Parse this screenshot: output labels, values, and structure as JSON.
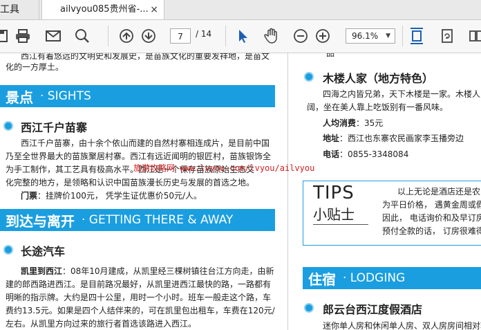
{
  "tabs": {
    "left_label": "工具",
    "doc_label": "ailvyou085贵州省-...",
    "close_glyph": "×"
  },
  "toolbar": {
    "page_current": "7",
    "page_total": "/ 14",
    "zoom": "96.1%"
  },
  "left": {
    "intro_tail_1": "西江有着悠远的文明史和发展史，是苗族文化的重要发祥地，是苗文",
    "intro_tail_2": "化的一方厚土。",
    "sights_banner_cn": "景点",
    "sights_banner_en": "· SIGHTS",
    "sight_title": "西江千户苗寨",
    "sight_body": [
      "西江千户苗寨，由十余个依山而建的自然村寨相连成片，是目前中国",
      "乃至全世界最大的苗族聚居村寨。西江有远近闻明的银匠村，苗族银饰全",
      "为手工制作，其工艺具有极高水平。西江是一个保存苗族原始生态文",
      "化完整的地方，是领略和认识中国苗族漫长历史与发展的首选之地。"
    ],
    "ticket_label": "门票",
    "ticket_value": "：挂牌价100元， 凭学生证优惠价50元/人。",
    "transport_banner_cn": "到达与离开",
    "transport_banner_en": "· GETTING THERE & AWAY",
    "bus_title": "长途汽车",
    "bus_lead": "凯里到西江",
    "bus_body_1": "：08年10月建成，从凯里经三棵树镇往台江方向走，由新",
    "bus_body": [
      "建的郎西路进西江。是目前路况最好，从凯里进西江最快的路，一路都有",
      "明晰的指示牌。大约是四十公里，用时一个小时。班车一般走这个路，车",
      "费约13.5元。如果是四个人结伴来的，可在凯里包出租车，车费在120元/",
      "左右。从凯里方向过来的旅行者首选该路进入西江。"
    ]
  },
  "watermark": "旅游攻略网  www.lvyou.com/lvyou/ailvyou",
  "right": {
    "top_fragment": "一品",
    "food_title": "木楼人家（地方特色）",
    "food_body_1": "四海之内皆兄弟，天下木楼是一家。木楼人家",
    "food_body_2": "阔，坐在美人靠上吃饭别有一番风味。",
    "price_label": "人均消费",
    "price_value": "：35元",
    "addr_label": "地址",
    "addr_value": "：西江也东寨农民画家李玉播旁边",
    "phone_label": "电话",
    "phone_value": "：0855-3348084",
    "tips_en": "TIPS",
    "tips_cn": "小贴士",
    "tips_body": [
      "以上无论是酒店还是农",
      "为平日价格， 遇黄金周或假",
      "因此， 电话询价和及早订房",
      "预付全款的话， 订房很难得"
    ],
    "lodging_banner_cn": "住宿",
    "lodging_banner_en": "· LODGING",
    "hotel_title": "郎云台西江度假酒店",
    "hotel_body": "迷你单人房和休闲单人房、双人房房间相对较"
  }
}
